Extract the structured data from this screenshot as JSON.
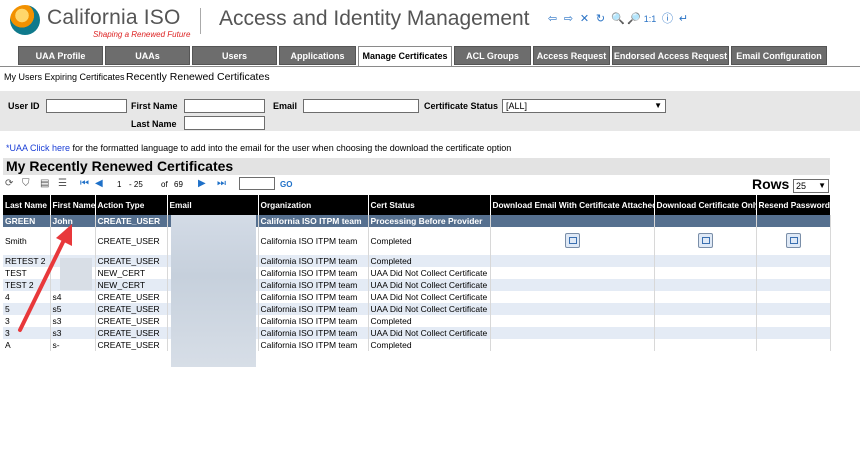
{
  "header": {
    "logo_text": "California ISO",
    "logo_tagline": "Shaping a Renewed Future",
    "app_title": "Access and Identity Management",
    "toolbar_icons": [
      "⇦",
      "⇨",
      "✕",
      "↻",
      "🔍",
      "🔎",
      "1:1",
      "ⓘ",
      "↵"
    ]
  },
  "tabs": [
    "UAA Profile",
    "UAAs",
    "Users",
    "Applications",
    "Manage Certificates",
    "ACL Groups",
    "Access Request",
    "Endorsed Access Request",
    "Email Configuration"
  ],
  "active_tab": "Manage Certificates",
  "subtabs": {
    "expiring": "My Users Expiring Certificates",
    "renewed": "Recently Renewed Certificates"
  },
  "filters": {
    "user_id_label": "User ID",
    "first_name_label": "First Name",
    "last_name_label": "Last Name",
    "email_label": "Email",
    "cert_status_label": "Certificate Status",
    "cert_status_value": "[ALL]"
  },
  "note": {
    "link": "*UAA Click here",
    "text": " for the formatted language to add into the email for the user when choosing the download the certificate option"
  },
  "grid": {
    "title": "My Recently Renewed Certificates",
    "page_current": "1",
    "page_range": "- 25",
    "of_label": "of",
    "total": "69",
    "go_label": "GO",
    "rows_label": "Rows",
    "rows_value": "25",
    "columns": [
      "Last Name",
      "First Name",
      "Action Type",
      "Email",
      "Organization",
      "Cert Status",
      "Download Email With Certificate Attached",
      "Download Certificate Only",
      "Resend Password"
    ],
    "rows": [
      {
        "last": "GREEN",
        "first": "John",
        "action": "CREATE_USER",
        "org": "California ISO ITPM team",
        "status": "Processing Before Provider",
        "icons": false
      },
      {
        "last": "Smith",
        "first": "",
        "action": "CREATE_USER",
        "org": "California ISO ITPM team",
        "status": "Completed",
        "icons": true
      },
      {
        "last": "RETEST 2",
        "first": "",
        "action": "CREATE_USER",
        "org": "California ISO ITPM team",
        "status": "Completed",
        "icons": false
      },
      {
        "last": "TEST",
        "first": "",
        "action": "NEW_CERT",
        "org": "California ISO ITPM team",
        "status": "UAA Did Not Collect Certificate",
        "icons": false
      },
      {
        "last": "TEST 2",
        "first": "",
        "action": "NEW_CERT",
        "org": "California ISO ITPM team",
        "status": "UAA Did Not Collect Certificate",
        "icons": false
      },
      {
        "last": "4",
        "first": "s4",
        "action": "CREATE_USER",
        "org": "California ISO ITPM team",
        "status": "UAA Did Not Collect Certificate",
        "icons": false
      },
      {
        "last": "5",
        "first": "s5",
        "action": "CREATE_USER",
        "org": "California ISO ITPM team",
        "status": "UAA Did Not Collect Certificate",
        "icons": false
      },
      {
        "last": "3",
        "first": "s3",
        "action": "CREATE_USER",
        "org": "California ISO ITPM team",
        "status": "Completed",
        "icons": false
      },
      {
        "last": "3",
        "first": "s3",
        "action": "CREATE_USER",
        "org": "California ISO ITPM team",
        "status": "UAA Did Not Collect Certificate",
        "icons": false
      },
      {
        "last": "A",
        "first": "s-",
        "action": "CREATE_USER",
        "org": "California ISO ITPM team",
        "status": "Completed",
        "icons": false
      }
    ]
  },
  "colors": {
    "tab_bg": "#6d6d6d",
    "highlight_row": "#56708f",
    "stripe_row": "#e4ebf5",
    "arrow": "#e8383b",
    "link": "#1a3ed6"
  }
}
